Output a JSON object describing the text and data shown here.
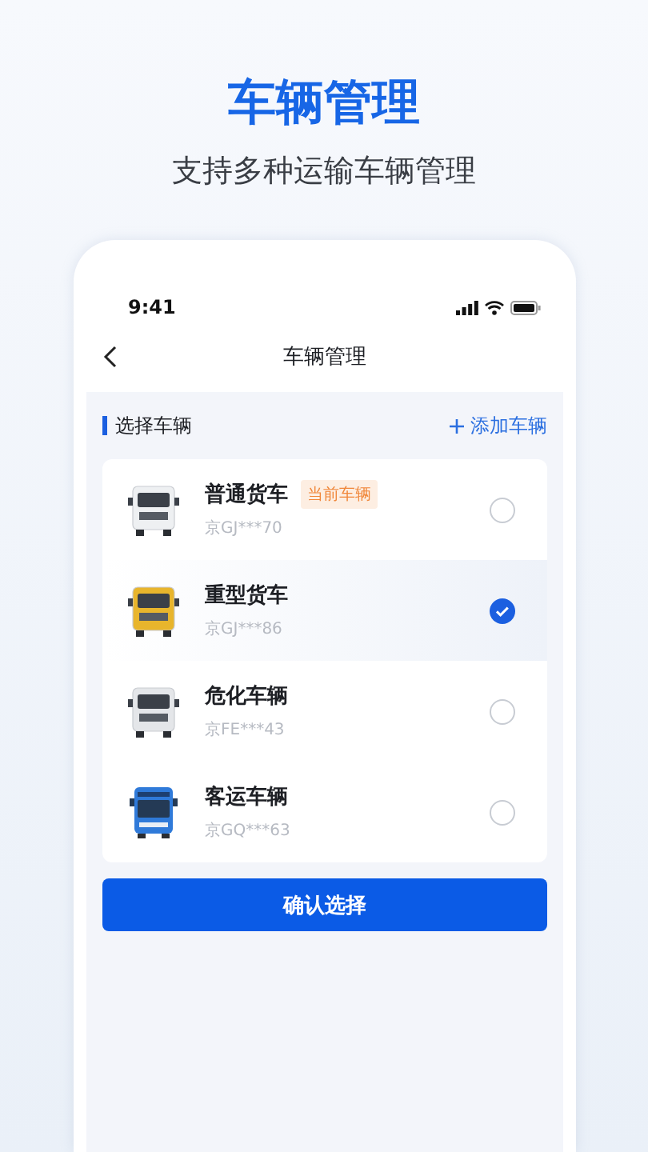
{
  "promo": {
    "title": "车辆管理",
    "subtitle": "支持多种运输车辆管理"
  },
  "status_bar": {
    "time": "9:41"
  },
  "nav": {
    "title": "车辆管理"
  },
  "section": {
    "title": "选择车辆",
    "action": "添加车辆"
  },
  "vehicles": [
    {
      "kind": "truck",
      "color": "#eef0f2",
      "name": "普通货车",
      "badge": "当前车辆",
      "plate": "京GJ***70",
      "selected": false
    },
    {
      "kind": "truck",
      "color": "#e8b52c",
      "name": "重型货车",
      "plate": "京GJ***86",
      "selected": true
    },
    {
      "kind": "truck",
      "color": "#e4e6e9",
      "name": "危化车辆",
      "plate": "京FE***43",
      "selected": false
    },
    {
      "kind": "bus",
      "color": "#2f7ad9",
      "name": "客运车辆",
      "plate": "京GQ***63",
      "selected": false
    }
  ],
  "confirm_button": "确认选择"
}
